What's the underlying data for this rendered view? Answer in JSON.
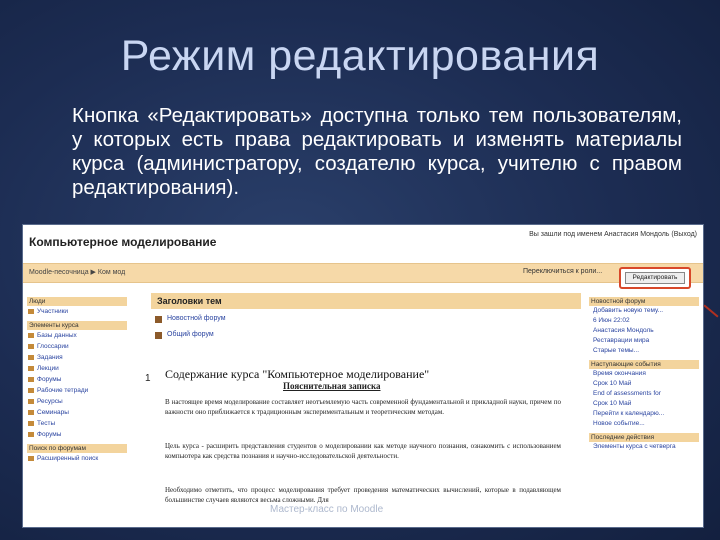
{
  "slide": {
    "title": "Режим редактирования",
    "body": "Кнопка «Редактировать» доступна только тем пользователям, у которых есть права редактировать и изменять материалы курса (администратору, создателю курса, учителю с правом редактирования)."
  },
  "screenshot": {
    "site_title": "Компьютерное моделирование",
    "login_info": "Вы зашли под именем Анастасия Мондоль (Выход)",
    "breadcrumb": "Moodle-песочница ▶ Ком мод",
    "role_switch": "Переключиться к роли...",
    "edit_button": "Редактировать",
    "left_blocks": [
      {
        "header": "Люди",
        "items": [
          "Участники"
        ]
      },
      {
        "header": "Элементы курса",
        "items": [
          "Базы данных",
          "Глоссарии",
          "Задания",
          "Лекции",
          "Форумы",
          "Рабочие тетради",
          "Ресурсы",
          "Семинары",
          "Тесты",
          "Форумы"
        ]
      },
      {
        "header": "Поиск по форумам",
        "items": [
          "Расширенный поиск"
        ]
      }
    ],
    "topics_header": "Заголовки тем",
    "forum_links": [
      "Новостной форум",
      "Общий форум"
    ],
    "section_number": "1",
    "section_title": "Содержание курса \"Компьютерное моделирование\"",
    "note_heading": "Пояснительная записка",
    "paragraphs": [
      "В настоящее время моделирование составляет неотъемлемую часть современной фундаментальной и прикладной науки, причем по важности оно приближается к традиционным экспериментальным и теоретическим методам.",
      "Цель курса - расширить представления студентов о моделировании как методе научного познания, ознакомить с использованием компьютера как средства познания и научно-исследовательской деятельности.",
      "Необходимо отметить, что процесс моделирования требует проведения математических вычислений, которые в подавляющем большинстве случаев являются весьма сложными. Для"
    ],
    "right_blocks": [
      {
        "header": "Новостной форум",
        "items": [
          "Добавить новую тему...",
          "6 Июн 22:02",
          "Анастасия Мондоль",
          "Реставрации мира",
          "Старые темы..."
        ]
      },
      {
        "header": "Наступающие события",
        "items": [
          "Время окончания",
          "Срок 10 Май",
          "End of assessments for",
          "Срок 10 Май",
          "Перейти к календарю...",
          "Новое событие..."
        ]
      },
      {
        "header": "Последние действия",
        "items": [
          "Элементы курса с четверга"
        ]
      }
    ]
  },
  "footer_watermark": "Мастер-класс по Moodle"
}
